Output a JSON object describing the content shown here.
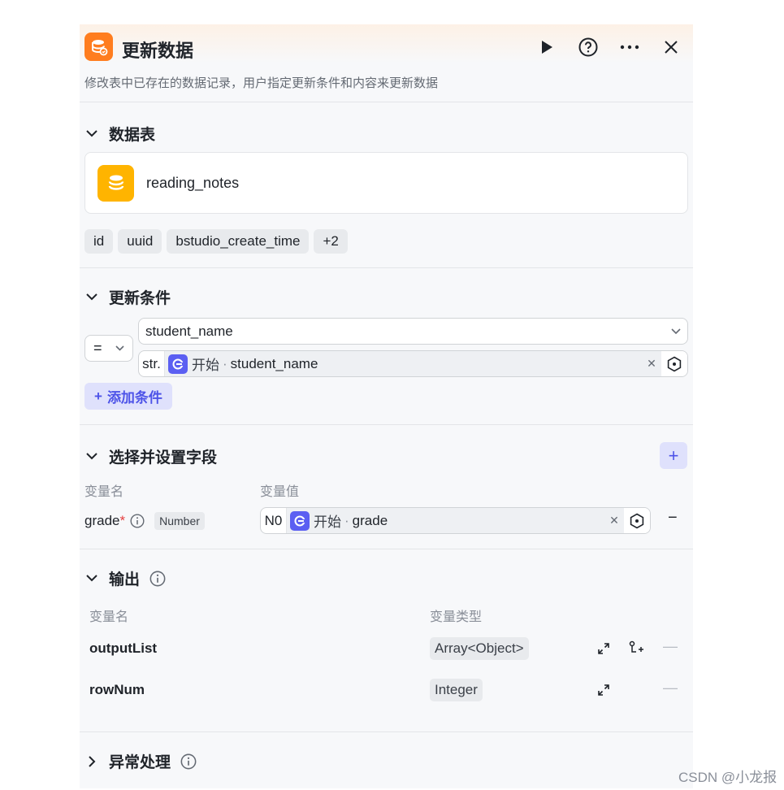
{
  "node": {
    "title": "更新数据",
    "description": "修改表中已存在的数据记录，用户指定更新条件和内容来更新数据",
    "icon": "database-icon",
    "accent_color": "#ff7d1f"
  },
  "header_actions": {
    "run": "play-icon",
    "help": "help-icon",
    "more": "more-icon",
    "close": "close-icon"
  },
  "table_section": {
    "title": "数据表",
    "table_name": "reading_notes",
    "table_icon_color": "#ffb400",
    "fields": [
      "id",
      "uuid",
      "bstudio_create_time",
      "+2"
    ]
  },
  "condition_section": {
    "title": "更新条件",
    "operator": "=",
    "field": "student_name",
    "value_type": "str.",
    "value_source": "开始",
    "value_separator": "·",
    "value_var": "student_name",
    "add_label": "添加条件"
  },
  "fields_section": {
    "title": "选择并设置字段",
    "col_name": "变量名",
    "col_value": "变量值",
    "row": {
      "name": "grade",
      "required": "*",
      "type": "Number",
      "value_type": "N0",
      "value_source": "开始",
      "value_separator": "·",
      "value_var": "grade"
    }
  },
  "output_section": {
    "title": "输出",
    "col_name": "变量名",
    "col_type": "变量类型",
    "rows": [
      {
        "name": "outputList",
        "type": "Array<Object>"
      },
      {
        "name": "rowNum",
        "type": "Integer"
      }
    ]
  },
  "exception_section": {
    "title": "异常处理"
  },
  "watermark": "CSDN @小龙报"
}
